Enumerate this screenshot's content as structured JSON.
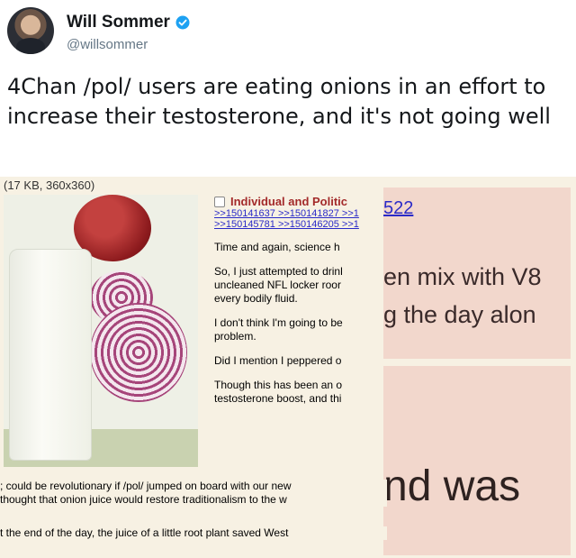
{
  "tweet": {
    "author_name": "Will Sommer",
    "author_handle": "@willsommer",
    "text": "4Chan /pol/ users are eating onions in an effort to increase their testosterone, and it's not going well",
    "verified_color": "#1da1f2"
  },
  "media": {
    "file_info": "(17 KB, 360x360)",
    "post": {
      "subject": "Individual and Politic",
      "reply_links_1": ">>150141637 >>150141827 >>1",
      "reply_links_2": ">>150145781 >>150146205 >>1",
      "lines": [
        "Time and again, science h",
        "So, I just attempted to drinl\nuncleaned NFL locker roor\nevery bodily fluid.",
        "I don't think I'm going to be\nproblem.",
        "Did I mention I peppered o",
        "Though this has been an o\ntestosterone boost, and thi"
      ]
    },
    "bottom_lines": [
      "; could be revolutionary if /pol/ jumped on board with our new",
      " thought that onion juice would restore traditionalism to the w",
      "t the end of the day, the juice of a little root plant saved West"
    ],
    "zoom_top": {
      "number": "522",
      "line_1": "en mix with V8",
      "line_2": "g the day alon"
    },
    "zoom_bottom": {
      "text": "nd was"
    }
  }
}
